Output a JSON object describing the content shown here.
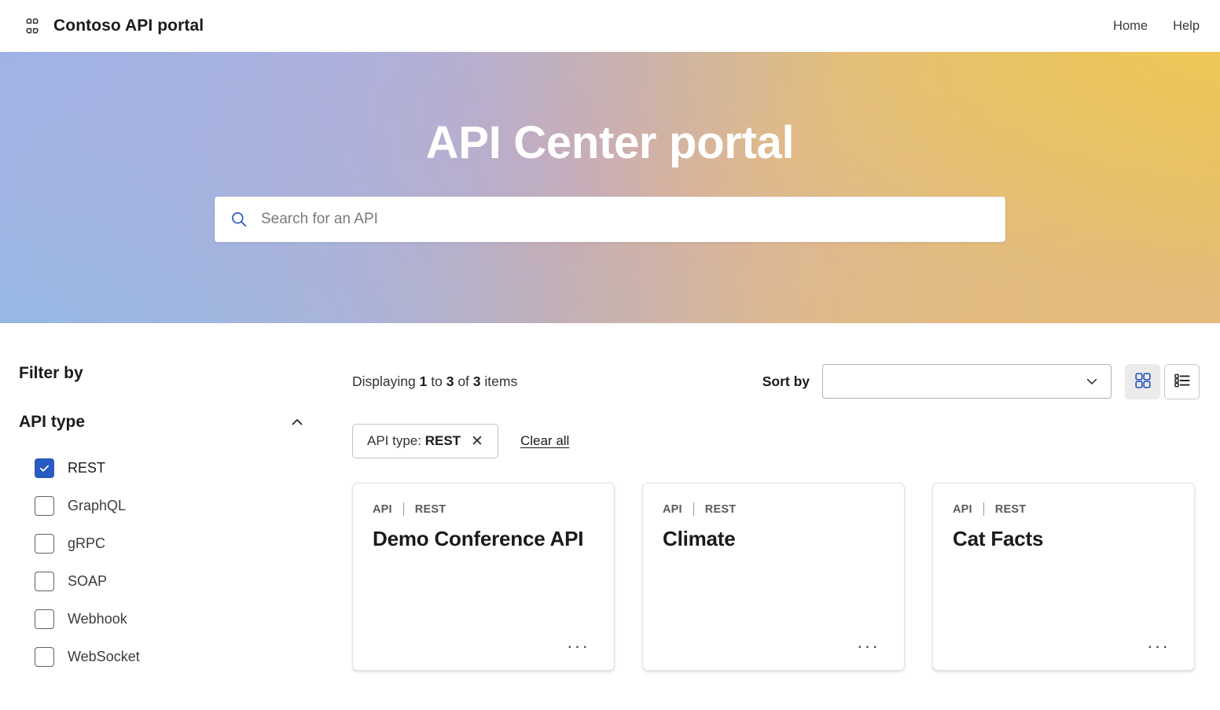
{
  "header": {
    "logo_icon": "clover-grid-icon",
    "brand_title": "Contoso API portal",
    "nav": [
      {
        "label": "Home",
        "name": "home"
      },
      {
        "label": "Help",
        "name": "help"
      }
    ]
  },
  "hero": {
    "title": "API Center portal",
    "search": {
      "icon": "search-icon",
      "placeholder": "Search for an API",
      "value": ""
    },
    "gradient": {
      "top_left": "#a8b6e2",
      "bottom_left": "#96b8e4",
      "middle": "#d0aab1",
      "top_right": "#e7c263",
      "bottom_right": "#e2ba7e"
    }
  },
  "sidebar": {
    "heading": "Filter by",
    "facets": [
      {
        "title": "API type",
        "collapse_icon": "chevron-up-icon",
        "expanded": true,
        "options": [
          {
            "label": "REST",
            "checked": true
          },
          {
            "label": "GraphQL",
            "checked": false
          },
          {
            "label": "gRPC",
            "checked": false
          },
          {
            "label": "SOAP",
            "checked": false
          },
          {
            "label": "Webhook",
            "checked": false
          },
          {
            "label": "WebSocket",
            "checked": false
          }
        ]
      }
    ]
  },
  "results": {
    "displaying": {
      "prefix": "Displaying",
      "from": "1",
      "middle": "to",
      "to": "3",
      "of": "of",
      "total": "3",
      "suffix": "items"
    },
    "sort": {
      "label": "Sort by",
      "value": "",
      "placeholder": "",
      "chevron_icon": "chevron-down-icon"
    },
    "view_toggle": {
      "grid": {
        "icon": "grid-view-icon",
        "active": true
      },
      "list": {
        "icon": "list-view-icon",
        "active": false
      }
    },
    "chips": [
      {
        "prefix": "API type: ",
        "value": "REST",
        "remove_icon": "close-icon"
      }
    ],
    "clear_all": "Clear all",
    "cards": [
      {
        "kind": "API",
        "type": "REST",
        "title": "Demo Conference API",
        "more_icon": "more-ellipsis-icon",
        "more_label": "···"
      },
      {
        "kind": "API",
        "type": "REST",
        "title": "Climate",
        "more_icon": "more-ellipsis-icon",
        "more_label": "···"
      },
      {
        "kind": "API",
        "type": "REST",
        "title": "Cat Facts",
        "more_icon": "more-ellipsis-icon",
        "more_label": "···"
      }
    ]
  },
  "colors": {
    "accent_blue": "#2a5bc0",
    "search_icon_blue": "#2b57c0",
    "text_primary": "#1b1b1b",
    "text_secondary": "#5b5b5b"
  }
}
